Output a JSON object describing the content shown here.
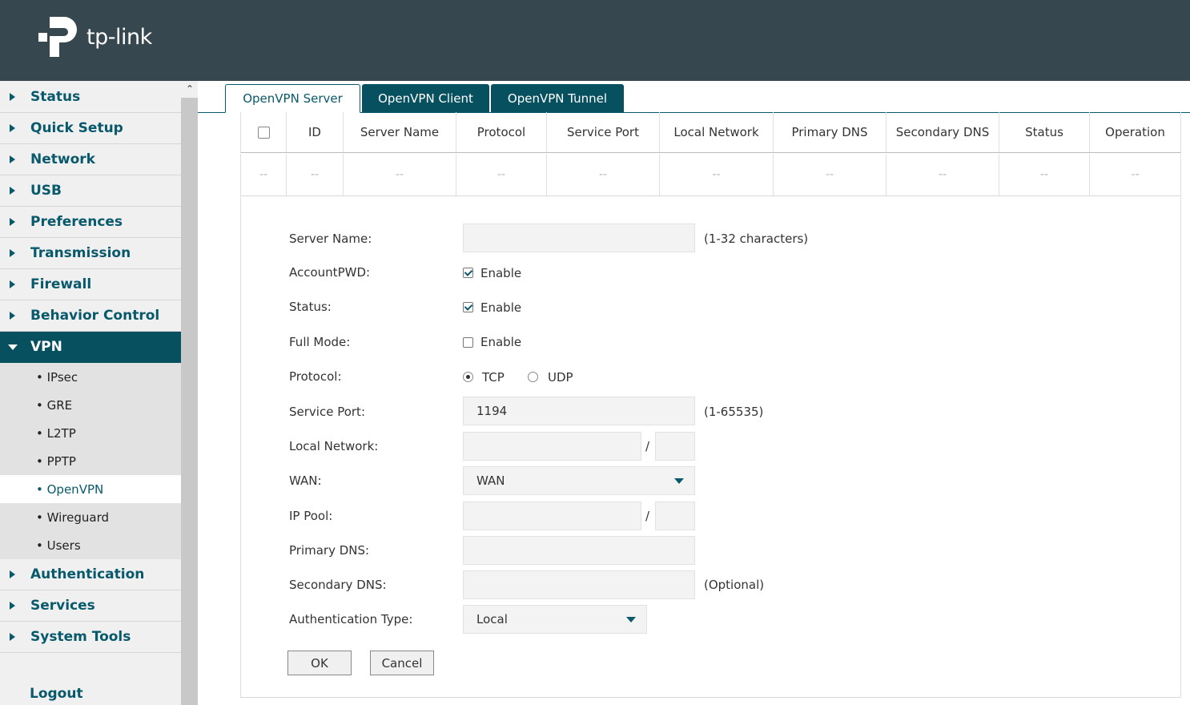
{
  "brand": {
    "logo_text": "tp-link"
  },
  "sidebar": {
    "items": [
      {
        "label": "Status"
      },
      {
        "label": "Quick Setup"
      },
      {
        "label": "Network"
      },
      {
        "label": "USB"
      },
      {
        "label": "Preferences"
      },
      {
        "label": "Transmission"
      },
      {
        "label": "Firewall"
      },
      {
        "label": "Behavior Control"
      },
      {
        "label": "VPN",
        "expanded": true
      },
      {
        "label": "Authentication"
      },
      {
        "label": "Services"
      },
      {
        "label": "System Tools"
      }
    ],
    "vpn_subitems": [
      {
        "label": "IPsec"
      },
      {
        "label": "GRE"
      },
      {
        "label": "L2TP"
      },
      {
        "label": "PPTP"
      },
      {
        "label": "OpenVPN",
        "selected": true
      },
      {
        "label": "Wireguard"
      },
      {
        "label": "Users"
      }
    ],
    "logout": "Logout"
  },
  "tabs": [
    {
      "label": "OpenVPN Server",
      "active": true
    },
    {
      "label": "OpenVPN Client"
    },
    {
      "label": "OpenVPN Tunnel"
    }
  ],
  "table": {
    "headers": [
      "ID",
      "Server Name",
      "Protocol",
      "Service Port",
      "Local Network",
      "Primary DNS",
      "Secondary DNS",
      "Status",
      "Operation"
    ],
    "empty_row": [
      "--",
      "--",
      "--",
      "--",
      "--",
      "--",
      "--",
      "--",
      "--",
      "--"
    ]
  },
  "form": {
    "server_name": {
      "label": "Server Name:",
      "value": "",
      "hint": "(1-32 characters)"
    },
    "account_pwd": {
      "label": "AccountPWD:",
      "checked": true,
      "option": "Enable"
    },
    "status": {
      "label": "Status:",
      "checked": true,
      "option": "Enable"
    },
    "full_mode": {
      "label": "Full Mode:",
      "checked": false,
      "option": "Enable"
    },
    "protocol": {
      "label": "Protocol:",
      "options": [
        "TCP",
        "UDP"
      ],
      "selected": "TCP"
    },
    "service_port": {
      "label": "Service Port:",
      "value": "1194",
      "hint": "(1-65535)"
    },
    "local_network": {
      "label": "Local Network:",
      "ip": "",
      "mask": "",
      "sep": "/"
    },
    "wan": {
      "label": "WAN:",
      "value": "WAN"
    },
    "ip_pool": {
      "label": "IP Pool:",
      "ip": "",
      "mask": "",
      "sep": "/"
    },
    "primary_dns": {
      "label": "Primary DNS:",
      "value": ""
    },
    "secondary_dns": {
      "label": "Secondary DNS:",
      "value": "",
      "hint": "(Optional)"
    },
    "auth_type": {
      "label": "Authentication Type:",
      "value": "Local"
    },
    "ok": "OK",
    "cancel": "Cancel"
  },
  "colors": {
    "header_bg": "#37474f",
    "accent": "#08596b",
    "active_bg": "#06505f"
  },
  "icons": {
    "scroll_up": "chevron-up-icon",
    "collapsed": "caret-right-icon",
    "expanded": "caret-down-icon",
    "dropdown": "caret-down-icon"
  }
}
